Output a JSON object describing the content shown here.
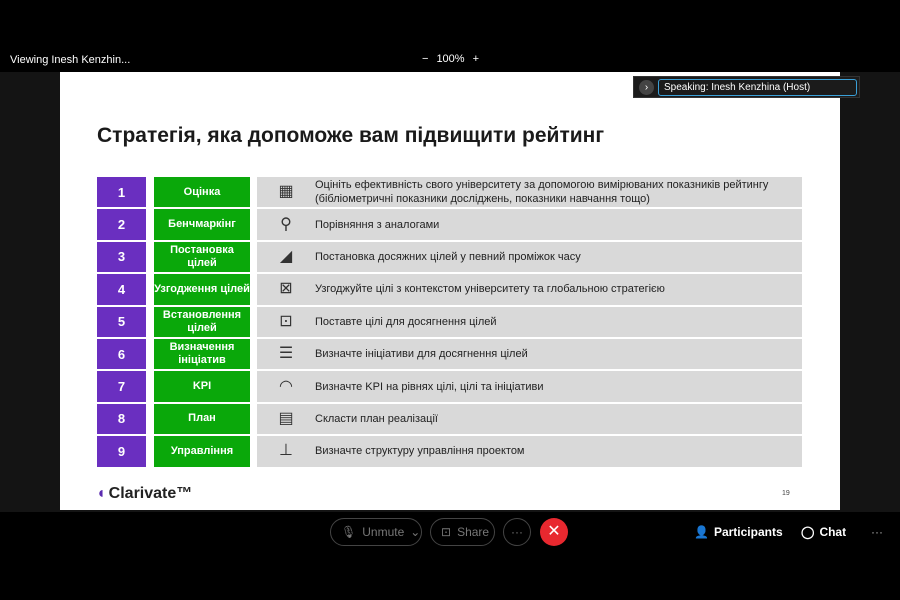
{
  "topbar": {
    "viewing": "Viewing Inesh Kenzhin...",
    "zoom_out": "−",
    "zoom_level": "100%",
    "zoom_in": "+"
  },
  "speaking": {
    "label": "Speaking: Inesh Kenzhina (Host)",
    "toggle": "›"
  },
  "slide": {
    "title": "Стратегія, яка допоможе вам підвищити рейтинг",
    "rows": [
      {
        "num": "1",
        "step": "Оцінка",
        "icon": "abacus-icon",
        "glyph": "▦",
        "desc": "Оцініть ефективність свого університету за допомогою вимірюваних показників рейтингу (бібліометричні показники досліджень, показники навчання тощо)"
      },
      {
        "num": "2",
        "step": "Бенчмаркінг",
        "icon": "benchmark-icon",
        "glyph": "⚲",
        "desc": "Порівняння з аналогами"
      },
      {
        "num": "3",
        "step": "Постановка цілей",
        "icon": "climber-icon",
        "glyph": "◢",
        "desc": "Постановка досяжних цілей у певний проміжок часу"
      },
      {
        "num": "4",
        "step": "Узгодження цілей",
        "icon": "strategy-board-icon",
        "glyph": "⊠",
        "desc": "Узгоджуйте цілі з контекстом університету та глобальною стратегією"
      },
      {
        "num": "5",
        "step": "Встановлення цілей",
        "icon": "presentation-board-icon",
        "glyph": "⊡",
        "desc": "Поставте цілі для досягнення цілей"
      },
      {
        "num": "6",
        "step": "Визначення ініціатив",
        "icon": "checklist-icon",
        "glyph": "☰",
        "desc": "Визначте ініціативи для досягнення цілей"
      },
      {
        "num": "7",
        "step": "KPI",
        "icon": "gauge-icon",
        "glyph": "◠",
        "desc": "Визначте KPI на рівнях цілі, цілі та ініціативи"
      },
      {
        "num": "8",
        "step": "План",
        "icon": "calendar-icon",
        "glyph": "▤",
        "desc": "Скласти план реалізації"
      },
      {
        "num": "9",
        "step": "Управління",
        "icon": "org-chart-icon",
        "glyph": "⊥",
        "desc": "Визначте структуру управління проектом"
      }
    ],
    "logo": "Clarivate™",
    "page": "19"
  },
  "controls": {
    "unmute": "Unmute",
    "share": "Share",
    "more": "···",
    "end": "✕",
    "participants": "Participants",
    "chat": "Chat",
    "overflow": "···"
  }
}
